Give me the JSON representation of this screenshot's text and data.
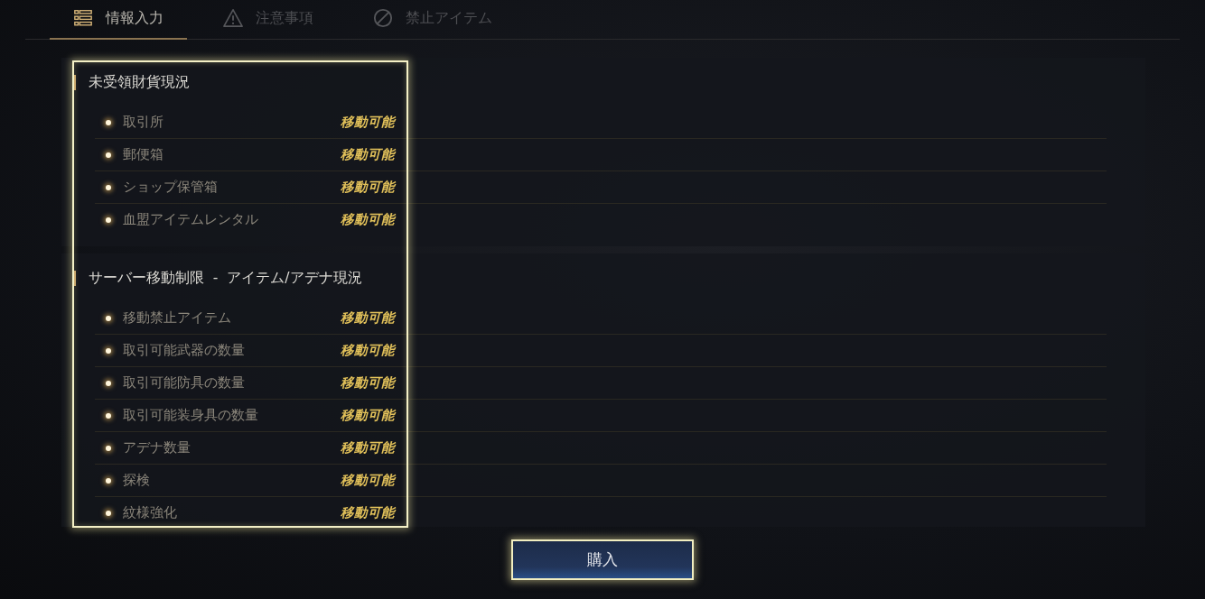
{
  "tabs": [
    {
      "label": "情報入力",
      "kind": "list",
      "selected": true
    },
    {
      "label": "注意事項",
      "kind": "warning",
      "selected": false
    },
    {
      "label": "禁止アイテム",
      "kind": "prohibited",
      "selected": false
    }
  ],
  "sections": [
    {
      "title": "未受領財貨現況",
      "rows": [
        {
          "label": "取引所",
          "status": "移動可能"
        },
        {
          "label": "郵便箱",
          "status": "移動可能"
        },
        {
          "label": "ショップ保管箱",
          "status": "移動可能"
        },
        {
          "label": "血盟アイテムレンタル",
          "status": "移動可能"
        }
      ]
    },
    {
      "title": "サーバー移動制限  -  アイテム/アデナ現況",
      "rows": [
        {
          "label": "移動禁止アイテム",
          "status": "移動可能"
        },
        {
          "label": "取引可能武器の数量",
          "status": "移動可能"
        },
        {
          "label": "取引可能防具の数量",
          "status": "移動可能"
        },
        {
          "label": "取引可能装身具の数量",
          "status": "移動可能"
        },
        {
          "label": "アデナ数量",
          "status": "移動可能"
        },
        {
          "label": "探検",
          "status": "移動可能"
        },
        {
          "label": "紋様強化",
          "status": "移動可能"
        }
      ]
    }
  ],
  "button": {
    "label": "購入"
  }
}
